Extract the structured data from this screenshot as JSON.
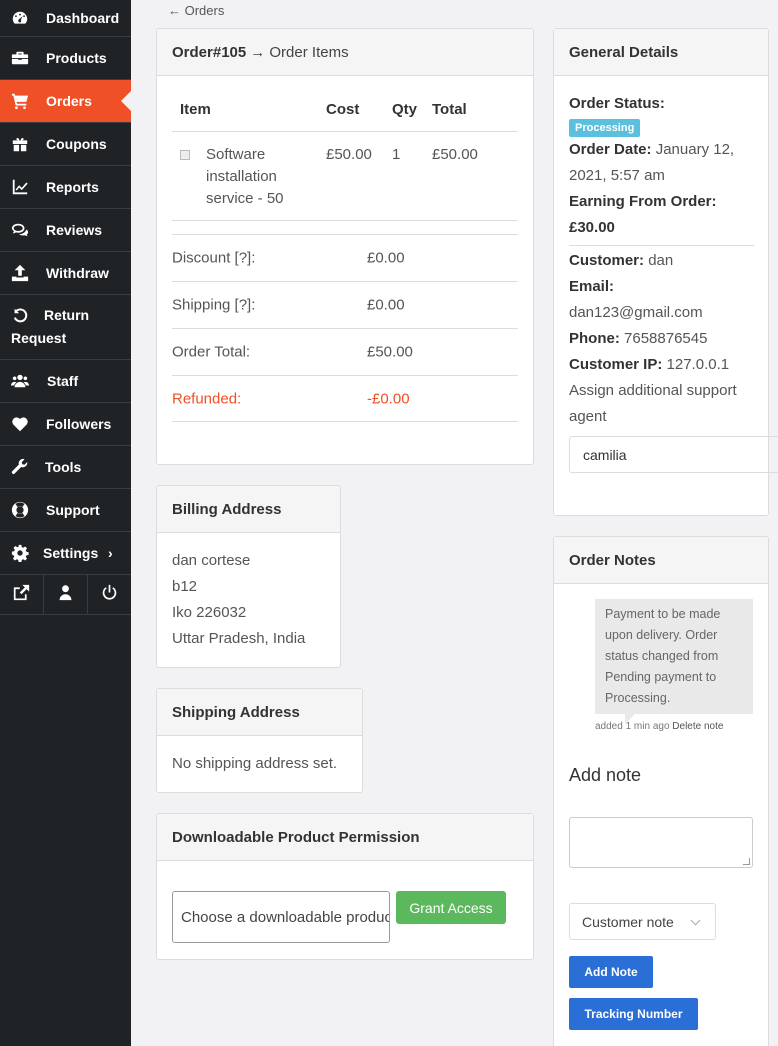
{
  "sidebar": {
    "items": [
      {
        "label": "Dashboard",
        "icon": "dashboard-icon"
      },
      {
        "label": "Products",
        "icon": "briefcase-icon"
      },
      {
        "label": "Orders",
        "icon": "cart-icon"
      },
      {
        "label": "Coupons",
        "icon": "gift-icon"
      },
      {
        "label": "Reports",
        "icon": "line-chart-icon"
      },
      {
        "label": "Reviews",
        "icon": "comments-icon"
      },
      {
        "label": "Withdraw",
        "icon": "upload-icon"
      },
      {
        "label_line1": "Return",
        "label_line2": "Request",
        "icon": "undo-icon"
      },
      {
        "label": "Staff",
        "icon": "users-icon"
      },
      {
        "label": "Followers",
        "icon": "heart-icon"
      },
      {
        "label": "Tools",
        "icon": "wrench-icon"
      },
      {
        "label": "Support",
        "icon": "lifebuoy-icon"
      },
      {
        "label": "Settings",
        "icon": "gear-icon"
      }
    ],
    "active": "Orders",
    "bottom_icons": [
      "external-link-icon",
      "user-icon",
      "power-icon"
    ]
  },
  "breadcrumb": {
    "back_label": "← Orders"
  },
  "order_items": {
    "title": "Order#105",
    "subtitle": "→ Order Items",
    "columns": [
      "Item",
      "Cost",
      "Qty",
      "Total"
    ],
    "rows": [
      {
        "item_line1": "Software",
        "item_line2": "installation",
        "item_line3": "service - 50",
        "cost": "£50.00",
        "qty": "1",
        "total": "£50.00"
      }
    ],
    "totals": [
      {
        "label": "Discount [?]:",
        "value": "£0.00"
      },
      {
        "label": "Shipping [?]:",
        "value": "£0.00"
      },
      {
        "label": "Order Total:",
        "value": "£50.00"
      },
      {
        "label": "Refunded:",
        "value": "-£0.00"
      }
    ]
  },
  "billing": {
    "title": "Billing Address",
    "lines": [
      "dan cortese",
      "b12",
      "Iko 226032",
      "Uttar Pradesh, India"
    ]
  },
  "shipping": {
    "title": "Shipping Address",
    "text": "No shipping address set."
  },
  "downloadable": {
    "title": "Downloadable Product Permission",
    "placeholder": "Choose a downloadable product…",
    "button": "Grant Access"
  },
  "general": {
    "title": "General Details",
    "status_label": "Order Status:",
    "status_value": "Processing",
    "date_label": "Order Date:",
    "date_value_1": "January 12,",
    "date_value_2": "2021, 5:57 am",
    "earning_label": "Earning From Order:",
    "earning_value": "£30.00",
    "customer_label": "Customer:",
    "customer_value": "dan",
    "email_label": "Email:",
    "email_value": "dan123@gmail.com",
    "phone_label": "Phone:",
    "phone_value": "7658876545",
    "ip_label": "Customer IP:",
    "ip_value": "127.0.0.1",
    "assign_label_1": "Assign additional support",
    "assign_label_2": "agent",
    "agent_value": "camilia",
    "status_color": "#5bc0de"
  },
  "notes": {
    "title": "Order Notes",
    "note_lines": [
      "Payment to be made",
      "upon delivery. Order",
      "status changed from",
      "Pending payment to",
      "Processing."
    ],
    "meta": "added 1 min ago",
    "delete_label": "Delete note",
    "add_title": "Add note",
    "type_value": "Customer note",
    "add_button": "Add Note",
    "tracking_button": "Tracking Number"
  },
  "colors": {
    "accent": "#f05025",
    "sidebar_bg": "#1f2326",
    "green": "#5cb85c",
    "blue": "#2a6fd6"
  }
}
